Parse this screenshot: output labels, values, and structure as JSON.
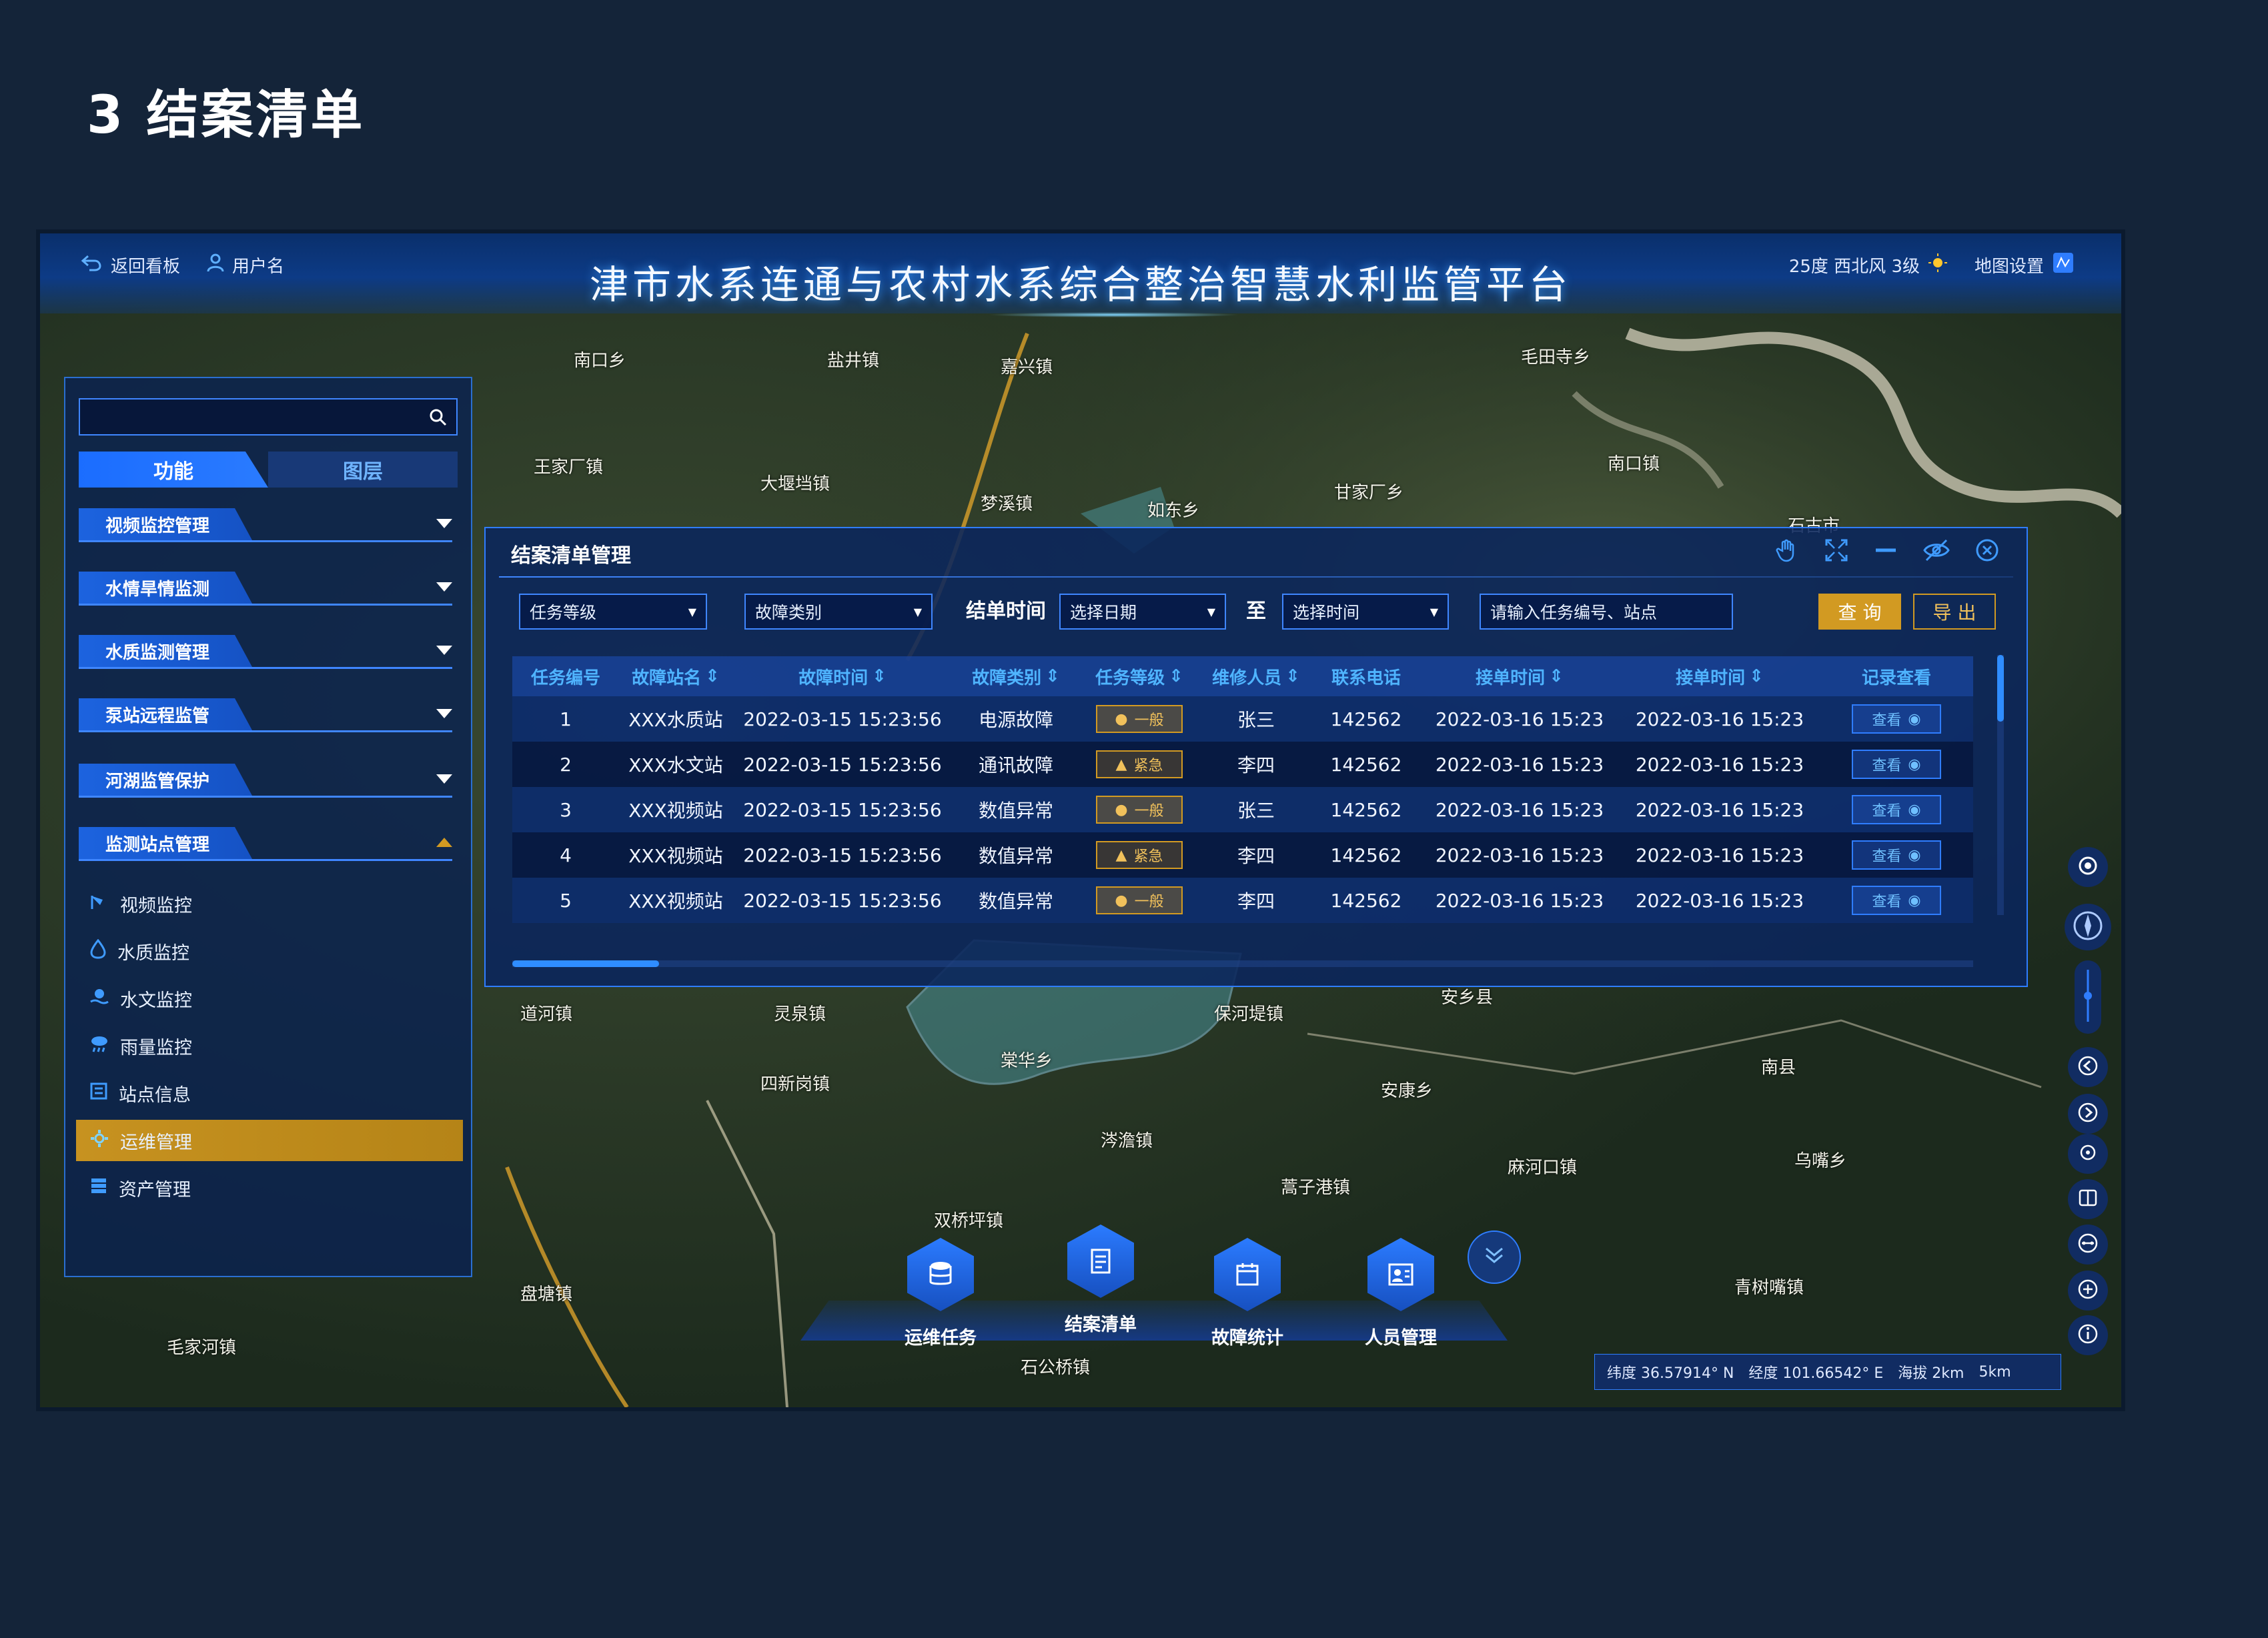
{
  "page_heading": "3 结案清单",
  "topbar": {
    "back_label": "返回看板",
    "user_label": "用户名",
    "title": "津市水系连通与农村水系综合整治智慧水利监管平台",
    "weather": "25度 西北风 3级",
    "map_settings": "地图设置"
  },
  "sidebar": {
    "search_placeholder": "",
    "tabs": [
      "功能",
      "图层"
    ],
    "groups": [
      "视频监控管理",
      "水情旱情监测",
      "水质监测管理",
      "泵站远程监管",
      "河湖监管保护",
      "监测站点管理"
    ],
    "sub_items": [
      "视频监控",
      "水质监控",
      "水文监控",
      "雨量监控",
      "站点信息",
      "运维管理",
      "资产管理"
    ],
    "active_sub": "运维管理"
  },
  "panel": {
    "title": "结案清单管理",
    "filters": {
      "task_level": "任务等级",
      "fault_type": "故障类别",
      "close_time_label": "结单时间",
      "date_placeholder": "选择日期",
      "to_label": "至",
      "time_placeholder": "选择时间",
      "search_placeholder": "请输入任务编号、站点"
    },
    "query_button": "查 询",
    "export_button": "导 出",
    "columns": [
      "任务编号",
      "故障站名",
      "故障时间",
      "故障类别",
      "任务等级",
      "维修人员",
      "联系电话",
      "接单时间",
      "接单时间",
      "记录查看"
    ],
    "rows": [
      {
        "id": "1",
        "station": "XXX水质站",
        "fault_time": "2022-03-15  15:23:56",
        "fault_type": "电源故障",
        "level": "一般",
        "staff": "张三",
        "phone": "142562",
        "accept1": "2022-03-16 15:23",
        "accept2": "2022-03-16 15:23",
        "view": "查看"
      },
      {
        "id": "2",
        "station": "XXX水文站",
        "fault_time": "2022-03-15  15:23:56",
        "fault_type": "通讯故障",
        "level": "紧急",
        "staff": "李四",
        "phone": "142562",
        "accept1": "2022-03-16 15:23",
        "accept2": "2022-03-16 15:23",
        "view": "查看"
      },
      {
        "id": "3",
        "station": "XXX视频站",
        "fault_time": "2022-03-15  15:23:56",
        "fault_type": "数值异常",
        "level": "一般",
        "staff": "张三",
        "phone": "142562",
        "accept1": "2022-03-16 15:23",
        "accept2": "2022-03-16 15:23",
        "view": "查看"
      },
      {
        "id": "4",
        "station": "XXX视频站",
        "fault_time": "2022-03-15  15:23:56",
        "fault_type": "数值异常",
        "level": "紧急",
        "staff": "李四",
        "phone": "142562",
        "accept1": "2022-03-16 15:23",
        "accept2": "2022-03-16 15:23",
        "view": "查看"
      },
      {
        "id": "5",
        "station": "XXX视频站",
        "fault_time": "2022-03-15  15:23:56",
        "fault_type": "数值异常",
        "level": "一般",
        "staff": "李四",
        "phone": "142562",
        "accept1": "2022-03-16 15:23",
        "accept2": "2022-03-16 15:23",
        "view": "查看"
      }
    ]
  },
  "dock": [
    "运维任务",
    "结案清单",
    "故障统计",
    "人员管理"
  ],
  "status": {
    "lat": "纬度  36.57914° N",
    "lng": "经度  101.66542° E",
    "alt": "海拔 2km",
    "scale": "5km"
  },
  "map_labels": [
    "南口乡",
    "盐井镇",
    "嘉兴镇",
    "毛田寺乡",
    "王家厂镇",
    "大堰垱镇",
    "梦溪镇",
    "如东乡",
    "甘家厂乡",
    "南口镇",
    "石古市",
    "道河镇",
    "灵泉镇",
    "四新岗镇",
    "棠华乡",
    "安乡县",
    "安康乡",
    "南县",
    "麻河口镇",
    "乌嘴乡",
    "蒿子港镇",
    "盘塘镇",
    "双桥坪镇",
    "石公桥镇",
    "青树嘴镇",
    "毛家河镇",
    "保河堤镇",
    "涔澹镇"
  ],
  "colors": {
    "accent": "#2f7dff",
    "highlight": "#d29a22",
    "background": "#142439"
  }
}
